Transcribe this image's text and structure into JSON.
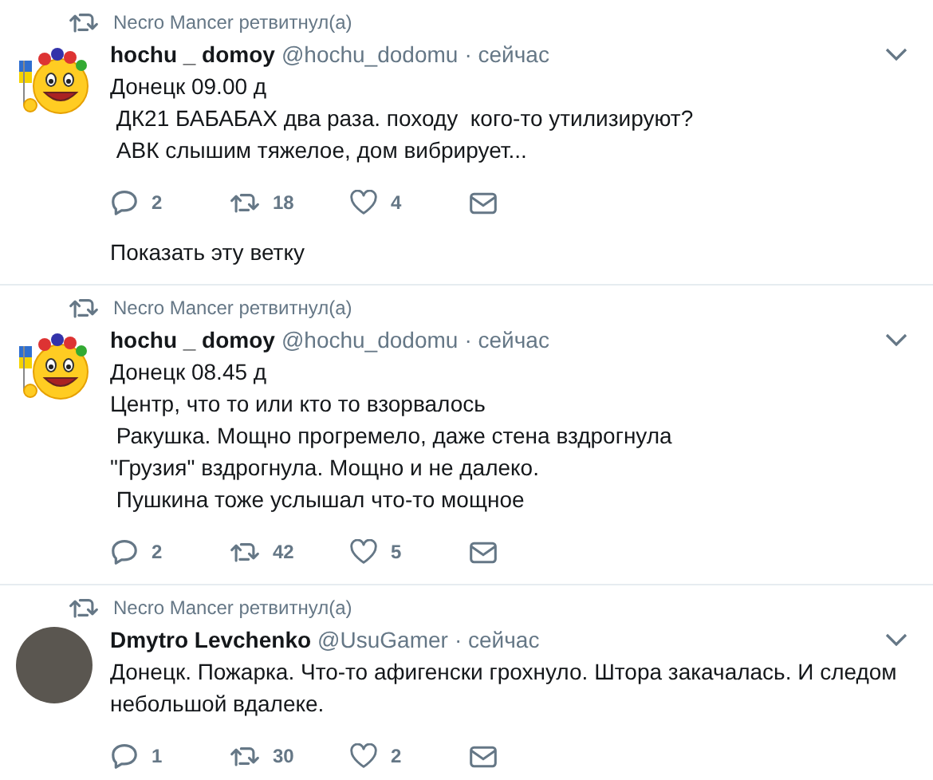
{
  "tweets": [
    {
      "retweeted_by": "Necro Mancer ретвитнул(а)",
      "avatar": {
        "kind": "emoji"
      },
      "name": "hochu _ domoy",
      "handle": "@hochu_dodomu",
      "time": "· сейчас",
      "text": "Донецк 09.00 д\n ДК21 БАБАБАХ два раза. походу  кого-то утилизируют?\n АВК слышим тяжелое, дом вибрирует...",
      "replies": "2",
      "retweets": "18",
      "likes": "4",
      "show_thread": "Показать эту ветку"
    },
    {
      "retweeted_by": "Necro Mancer ретвитнул(а)",
      "avatar": {
        "kind": "emoji"
      },
      "name": "hochu _ domoy",
      "handle": "@hochu_dodomu",
      "time": "· сейчас",
      "text": "Донецк 08.45 д\nЦентр, что то или кто то взорвалось\n Ракушка. Мощно прогремело, даже стена вздрогнула\n\"Грузия\" вздрогнула. Мощно и не далеко.\n Пушкина тоже услышал что-то мощное",
      "replies": "2",
      "retweets": "42",
      "likes": "5"
    },
    {
      "retweeted_by": "Necro Mancer ретвитнул(а)",
      "avatar": {
        "kind": "photo"
      },
      "name": "Dmytro Levchenko",
      "handle": "@UsuGamer",
      "time": "· сейчас",
      "text": "Донецк. Пожарка. Что-то афигенски грохнуло. Штора закачалась. И следом небольшой вдалеке.",
      "replies": "1",
      "retweets": "30",
      "likes": "2"
    }
  ]
}
